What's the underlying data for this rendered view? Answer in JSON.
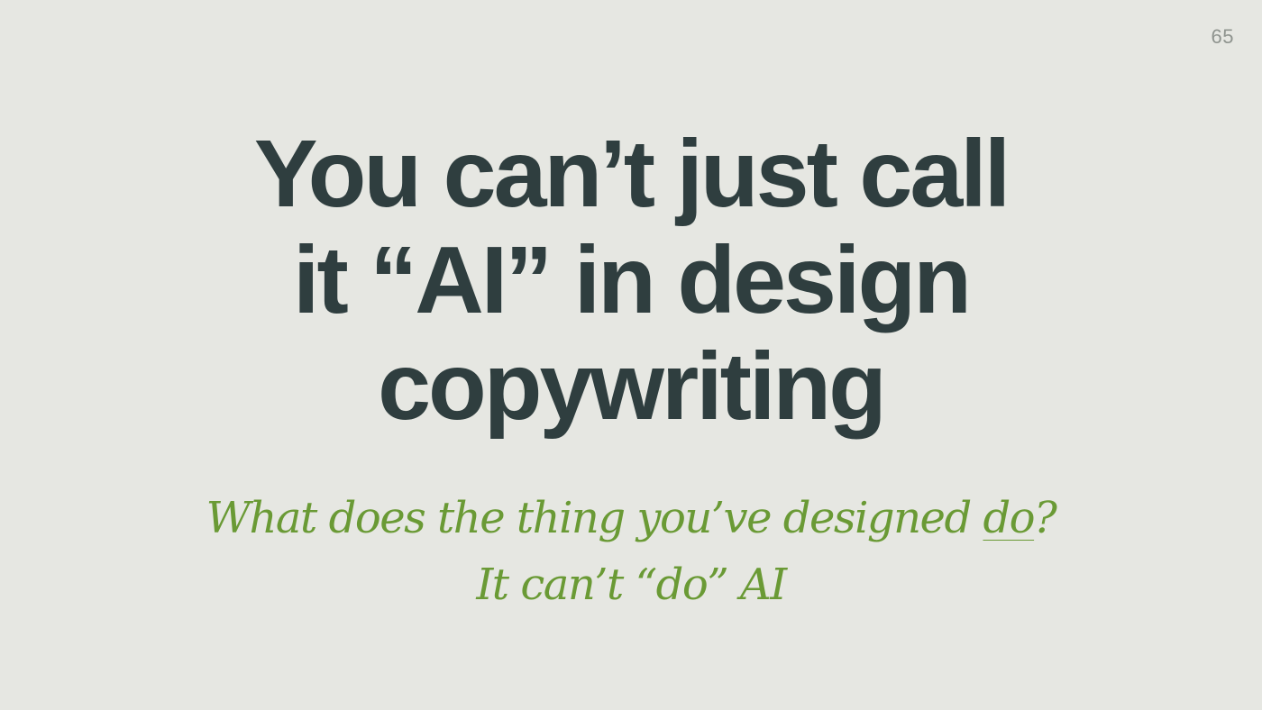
{
  "slide": {
    "page_number": "65",
    "headline_lines": [
      "You can’t just call",
      "it “AI” in design",
      "copywriting"
    ],
    "subtitle": {
      "line1_before": "What does the thing you’ve designed ",
      "line1_emphasis": "do",
      "line1_after": "?",
      "line2": "It can’t “do” AI"
    },
    "colors": {
      "background": "#e6e7e2",
      "headline": "#2f3e3f",
      "subtitle": "#6a9a35",
      "page_number": "#8f948f"
    }
  }
}
